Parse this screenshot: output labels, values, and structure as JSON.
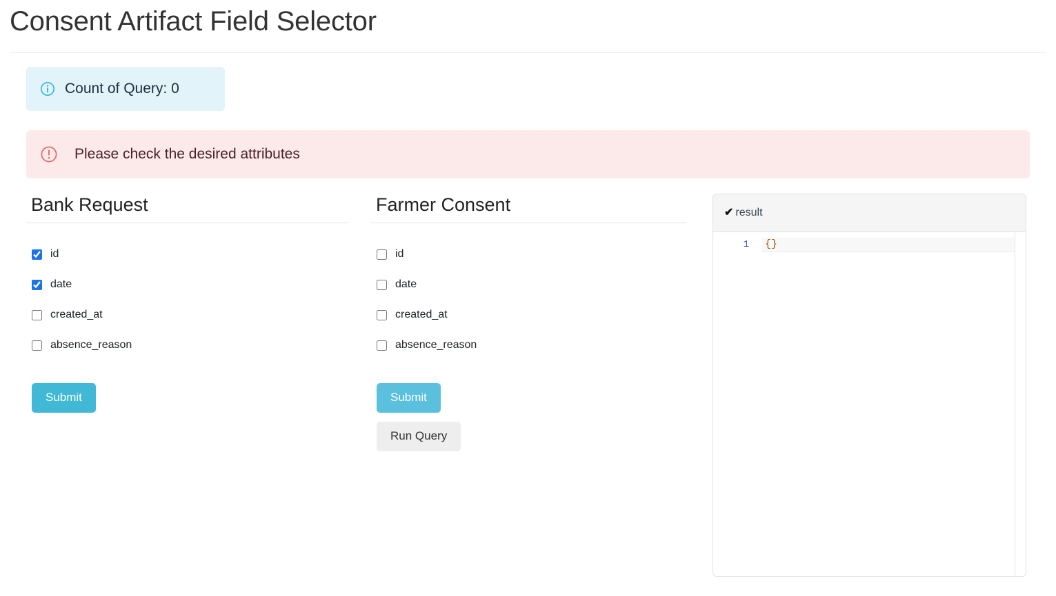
{
  "page": {
    "title": "Consent Artifact Field Selector"
  },
  "alerts": {
    "info": {
      "icon": "info-circle-icon",
      "text": "Count of Query: 0",
      "color": "#e2f3fa"
    },
    "danger": {
      "icon": "exclamation-circle-icon",
      "text": "Please check the desired attributes",
      "color": "#fceaea"
    }
  },
  "columns": {
    "bank": {
      "heading": "Bank Request",
      "fields": [
        {
          "label": "id",
          "checked": true
        },
        {
          "label": "date",
          "checked": true
        },
        {
          "label": "created_at",
          "checked": false
        },
        {
          "label": "absence_reason",
          "checked": false
        }
      ],
      "submit_label": "Submit"
    },
    "farmer": {
      "heading": "Farmer Consent",
      "fields": [
        {
          "label": "id",
          "checked": false
        },
        {
          "label": "date",
          "checked": false
        },
        {
          "label": "created_at",
          "checked": false
        },
        {
          "label": "absence_reason",
          "checked": false
        }
      ],
      "submit_label": "Submit",
      "run_query_label": "Run Query"
    }
  },
  "result": {
    "check_icon": "check-mark-icon",
    "title": "result",
    "line_number": "1",
    "code": "{}"
  },
  "theme": {
    "accent": "#41b9d6",
    "checkbox": "#1a73e8",
    "info_icon": "#29b6ea",
    "danger_icon": "#e06a6a"
  }
}
